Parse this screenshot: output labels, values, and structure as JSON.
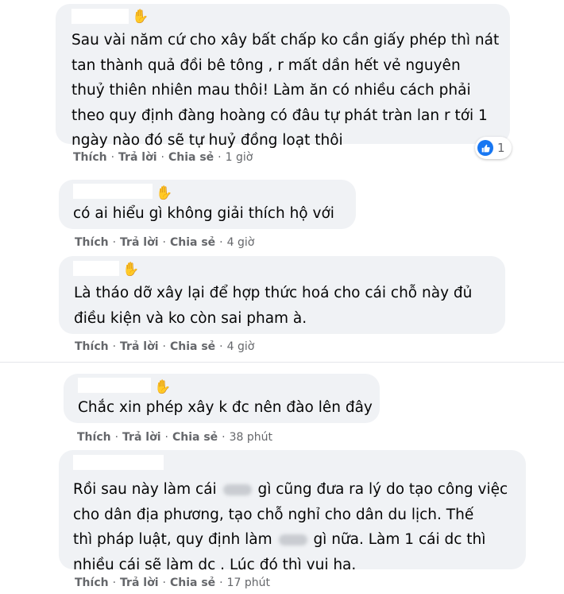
{
  "comments": [
    {
      "lines": [
        "Sau vài năm cứ cho xây bất chấp ko cần giấy phép thì nát",
        "tan thành quả đồi bê tông , r mất dần hết vẻ nguyên",
        "thuỷ thiên nhiên mau thôi! Làm ăn có nhiều cách phải",
        "theo quy định đàng hoàng có đâu tự phát tràn lan r tới 1",
        "ngày nào đó sẽ tự huỷ đồng loạt thôi"
      ],
      "actions": {
        "like": "Thích",
        "reply": "Trả lời",
        "share": "Chia sẻ",
        "time": "1 giờ"
      },
      "reaction_count": "1"
    },
    {
      "lines": [
        "có ai hiểu gì không giải thích hộ với"
      ],
      "actions": {
        "like": "Thích",
        "reply": "Trả lời",
        "share": "Chia sẻ",
        "time": "4 giờ"
      }
    },
    {
      "lines": [
        "Là tháo dỡ xây lại để hợp thức hoá cho cái chỗ này đủ",
        "điều kiện và ko còn sai pham à."
      ],
      "actions": {
        "like": "Thích",
        "reply": "Trả lời",
        "share": "Chia sẻ",
        "time": "4 giờ"
      }
    },
    {
      "lines": [
        "Chắc xin phép xây k đc nên đào lên đây"
      ],
      "actions": {
        "like": "Thích",
        "reply": "Trả lời",
        "share": "Chia sẻ",
        "time": "38 phút"
      }
    },
    {
      "line1_a": "Rồi sau này làm cái",
      "line1_b": "gì cũng đưa ra lý do tạo công việc",
      "line2": "cho dân địa phương, tạo chỗ nghỉ cho dân du lịch. Thế",
      "line3_a": "thì pháp luật, quy định làm",
      "line3_b": "gì nữa. Làm 1 cái dc thì",
      "line4": "nhiều cái sẽ làm dc . Lúc đó thì vui ha.",
      "actions": {
        "like": "Thích",
        "reply": "Trả lời",
        "share": "Chia sẻ",
        "time": "17 phút"
      }
    }
  ],
  "colors": {
    "bubble": "#f0f2f5",
    "meta": "#65676b",
    "like_blue": "#1877f2"
  },
  "icons": [
    "wave-hand-icon",
    "like-thumb-icon"
  ]
}
